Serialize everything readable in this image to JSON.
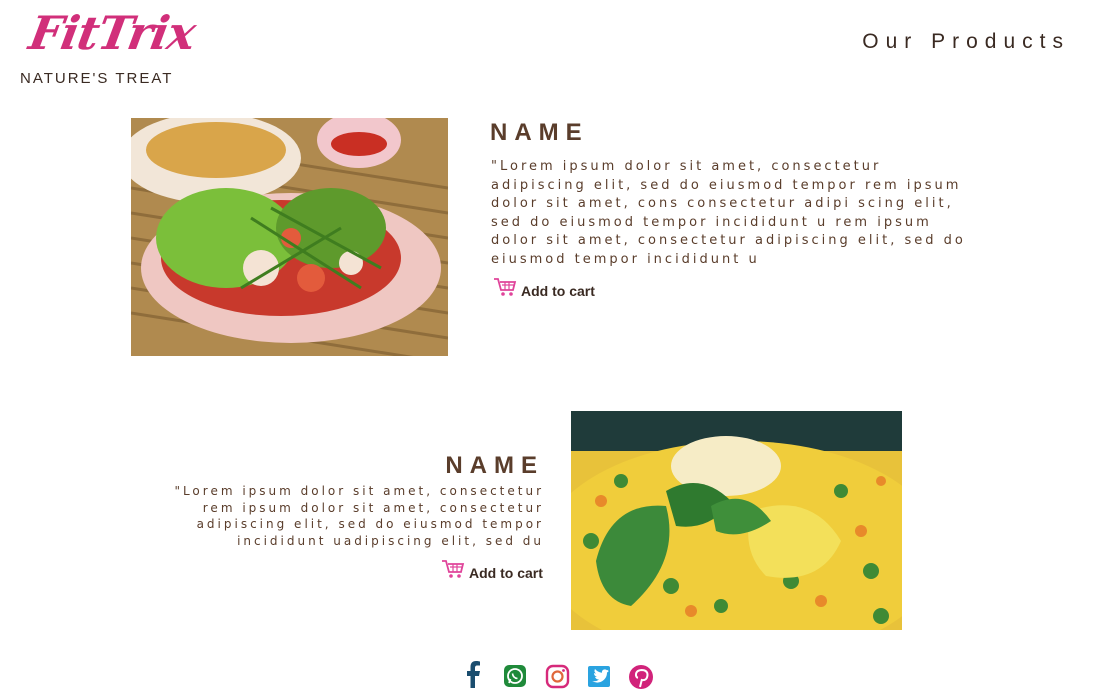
{
  "brand": {
    "name": "FitTrix",
    "tagline": "NATURE'S TREAT",
    "accent_color": "#d12f7a"
  },
  "nav": {
    "products_label": "Our Products"
  },
  "products": [
    {
      "name": "NAME",
      "description": "\"Lorem ipsum dolor sit amet, consectetur adipiscing elit, sed do eiusmod tempor rem ipsum dolor sit amet, cons consectetur adipi scing elit, sed do eiusmod tempor incididunt u  rem ipsum dolor sit amet, consectetur adipiscing elit, sed do eiusmod tempor incididunt u",
      "cart_label": "Add to cart",
      "image": "seafood-salad-plate"
    },
    {
      "name": "NAME",
      "description": "\"Lorem ipsum dolor sit amet, consectetur  rem ipsum dolor sit amet, consectetur adipiscing elit, sed do eiusmod tempor incididunt uadipiscing elit, sed du",
      "cart_label": "Add to cart",
      "image": "vegetable-rice-paella"
    }
  ],
  "social": [
    {
      "name": "facebook-icon",
      "color": "#1a4d6e"
    },
    {
      "name": "whatsapp-icon",
      "color": "#1f8a3a"
    },
    {
      "name": "instagram-icon",
      "color": "#d6297a"
    },
    {
      "name": "twitter-icon",
      "color": "#2aa3e0"
    },
    {
      "name": "pinterest-icon",
      "color": "#d1237a"
    }
  ]
}
